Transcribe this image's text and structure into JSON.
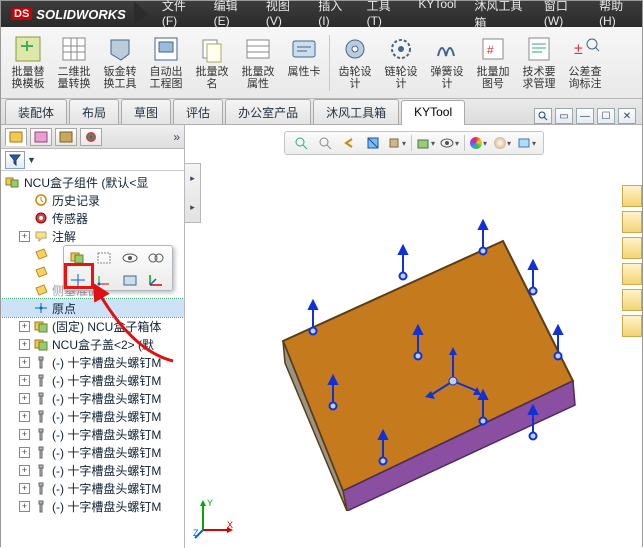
{
  "app": {
    "logo_text": "SOLIDWORKS"
  },
  "menu": [
    "文件(F)",
    "编辑(E)",
    "视图(V)",
    "插入(I)",
    "工具(T)",
    "KYTool",
    "沐风工具箱",
    "窗口(W)",
    "帮助(H)"
  ],
  "ribbon": [
    {
      "label": "批量替\n换模板",
      "icon": "swap"
    },
    {
      "label": "二维批\n量转换",
      "icon": "grid"
    },
    {
      "label": "钣金转\n换工具",
      "icon": "sheet"
    },
    {
      "label": "自动出\n工程图",
      "icon": "drawing"
    },
    {
      "label": "批量改\n名",
      "icon": "rename"
    },
    {
      "label": "批量改\n属性",
      "icon": "props"
    },
    {
      "label": "属性卡",
      "icon": "card"
    },
    {
      "label": "齿轮设\n计",
      "icon": "gear"
    },
    {
      "label": "链轮设\n计",
      "icon": "sprocket"
    },
    {
      "label": "弹簧设\n计",
      "icon": "spring"
    },
    {
      "label": "批量加\n图号",
      "icon": "number"
    },
    {
      "label": "技术要\n求管理",
      "icon": "tech"
    },
    {
      "label": "公差查\n询标注",
      "icon": "tol"
    }
  ],
  "tabs": [
    "装配体",
    "布局",
    "草图",
    "评估",
    "办公室产品",
    "沐风工具箱",
    "KYTool"
  ],
  "active_tab": 6,
  "side_tabs": [
    "assembly",
    "config",
    "display",
    "appearance"
  ],
  "filter_label": "▼",
  "tree": {
    "root": "NCU盒子组件  (默认<显",
    "nodes": [
      {
        "icon": "history",
        "label": "历史记录",
        "indent": 1,
        "tw": ""
      },
      {
        "icon": "sensor",
        "label": "传感器",
        "indent": 1,
        "tw": ""
      },
      {
        "icon": "annot",
        "label": "注解",
        "indent": 1,
        "tw": "+",
        "gold": true
      },
      {
        "icon": "plane",
        "label": "",
        "indent": 1,
        "tw": "",
        "gold": true
      },
      {
        "icon": "plane",
        "label": "",
        "indent": 1,
        "tw": "",
        "gold": true
      },
      {
        "icon": "plane",
        "label": "侧基准面",
        "indent": 1,
        "tw": "",
        "gold": true,
        "dim": true
      },
      {
        "icon": "origin",
        "label": "原点",
        "indent": 1,
        "tw": "",
        "sel": true
      },
      {
        "icon": "part",
        "label": "(固定) NCU盒子箱体",
        "indent": 1,
        "tw": "+",
        "gold": true
      },
      {
        "icon": "part",
        "label": "NCU盒子盖<2> (默",
        "indent": 1,
        "tw": "+",
        "gold": true
      },
      {
        "icon": "screw",
        "label": "(-) 十字槽盘头螺钉M",
        "indent": 1,
        "tw": "+"
      },
      {
        "icon": "screw",
        "label": "(-) 十字槽盘头螺钉M",
        "indent": 1,
        "tw": "+"
      },
      {
        "icon": "screw",
        "label": "(-) 十字槽盘头螺钉M",
        "indent": 1,
        "tw": "+"
      },
      {
        "icon": "screw",
        "label": "(-) 十字槽盘头螺钉M",
        "indent": 1,
        "tw": "+"
      },
      {
        "icon": "screw",
        "label": "(-) 十字槽盘头螺钉M",
        "indent": 1,
        "tw": "+"
      },
      {
        "icon": "screw",
        "label": "(-) 十字槽盘头螺钉M",
        "indent": 1,
        "tw": "+"
      },
      {
        "icon": "screw",
        "label": "(-) 十字槽盘头螺钉M",
        "indent": 1,
        "tw": "+"
      },
      {
        "icon": "screw",
        "label": "(-) 十字槽盘头螺钉M",
        "indent": 1,
        "tw": "+"
      },
      {
        "icon": "screw",
        "label": "(-) 十字槽盘头螺钉M",
        "indent": 1,
        "tw": "+"
      }
    ]
  },
  "ctx_icons": [
    "part",
    "hide",
    "eye",
    "mate",
    "axes",
    "origin",
    "view",
    "coord"
  ],
  "triad": {
    "x": "X",
    "y": "Y",
    "z": "Z"
  },
  "colors": {
    "box_top": "#c57a1e",
    "box_side": "#8a4fa0",
    "box_edge": "#5a3d12",
    "arrow_blue": "#1030d8",
    "arrow_red": "#e01010"
  }
}
